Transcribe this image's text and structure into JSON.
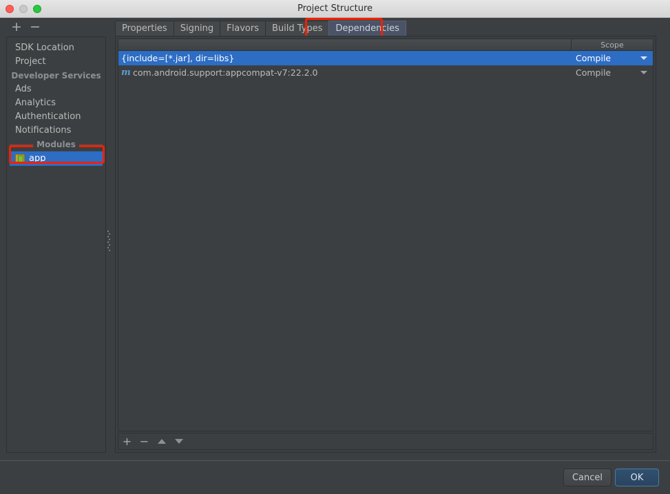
{
  "window": {
    "title": "Project Structure",
    "controls": [
      {
        "name": "close-button",
        "color": "#ff5f57"
      },
      {
        "name": "minimize-button",
        "color": "#c8c8c8"
      },
      {
        "name": "maximize-button",
        "color": "#28c840"
      }
    ]
  },
  "toolbar": {
    "add_label": "+",
    "remove_label": "−"
  },
  "sidebar": {
    "items": [
      {
        "label": "SDK Location",
        "type": "item",
        "selected": false
      },
      {
        "label": "Project",
        "type": "item",
        "selected": false
      },
      {
        "label": "Developer Services",
        "type": "group"
      },
      {
        "label": "Ads",
        "type": "item",
        "selected": false
      },
      {
        "label": "Analytics",
        "type": "item",
        "selected": false
      },
      {
        "label": "Authentication",
        "type": "item",
        "selected": false
      },
      {
        "label": "Notifications",
        "type": "item",
        "selected": false
      },
      {
        "label": "Modules",
        "type": "group"
      },
      {
        "label": "app",
        "type": "module",
        "selected": true,
        "icon": "android-module-icon"
      }
    ],
    "selected_item": "app",
    "selection_highlight_color": "#2d6dc4",
    "annotation_color": "#f22000"
  },
  "tabs": {
    "items": [
      {
        "label": "Properties",
        "active": false
      },
      {
        "label": "Signing",
        "active": false
      },
      {
        "label": "Flavors",
        "active": false
      },
      {
        "label": "Build Types",
        "active": false
      },
      {
        "label": "Dependencies",
        "active": true
      }
    ],
    "active_tab": "Dependencies",
    "active_tab_color": "#4b5366",
    "annotation_color": "#f22000"
  },
  "dependencies_table": {
    "columns": [
      {
        "key": "name",
        "label": ""
      },
      {
        "key": "scope",
        "label": "Scope"
      }
    ],
    "rows": [
      {
        "icon": "",
        "name": "{include=[*.jar], dir=libs}",
        "scope": "Compile",
        "selected": true
      },
      {
        "icon": "maven-icon",
        "name": "com.android.support:appcompat-v7:22.2.0",
        "scope": "Compile",
        "selected": false
      }
    ]
  },
  "table_toolbar": {
    "buttons": [
      {
        "name": "add-dependency-button",
        "label": "+",
        "glyph": "plus"
      },
      {
        "name": "remove-dependency-button",
        "label": "−",
        "glyph": "minus"
      },
      {
        "name": "move-up-button",
        "label": "",
        "glyph": "triangle-up"
      },
      {
        "name": "move-down-button",
        "label": "",
        "glyph": "triangle-down"
      }
    ]
  },
  "footer": {
    "cancel_label": "Cancel",
    "ok_label": "OK",
    "ok_accent_color": "#31506f"
  }
}
